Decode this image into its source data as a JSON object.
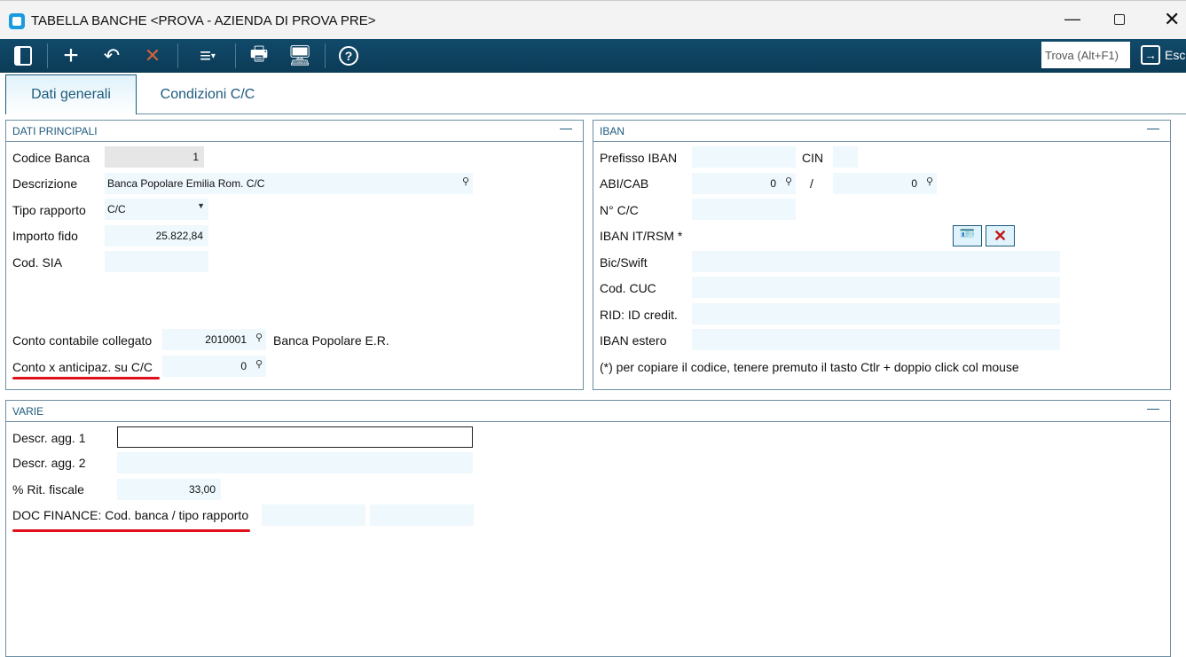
{
  "window": {
    "title": "TABELLA BANCHE <PROVA - AZIENDA DI PROVA PRE>"
  },
  "toolbar": {
    "search_placeholder": "Trova (Alt+F1)",
    "exit_label": "Esci"
  },
  "tabs": [
    {
      "label": "Dati generali",
      "active": true
    },
    {
      "label": "Condizioni C/C",
      "active": false
    }
  ],
  "dati_principali": {
    "title": "DATI PRINCIPALI",
    "codice_banca_label": "Codice Banca",
    "codice_banca": "1",
    "descrizione_label": "Descrizione",
    "descrizione": "Banca Popolare Emilia Rom. C/C",
    "tipo_rapporto_label": "Tipo rapporto",
    "tipo_rapporto": "C/C",
    "importo_fido_label": "Importo fido",
    "importo_fido": "25.822,84",
    "cod_sia_label": "Cod. SIA",
    "cod_sia": "",
    "conto_collegato_label": "Conto contabile collegato",
    "conto_collegato": "2010001",
    "conto_collegato_desc": "Banca Popolare E.R.",
    "conto_anticipaz_label": "Conto x anticipaz. su C/C",
    "conto_anticipaz": "0"
  },
  "iban": {
    "title": "IBAN",
    "prefisso_label": "Prefisso IBAN",
    "cin_label": "CIN",
    "abicab_label": "ABI/CAB",
    "abi": "0",
    "slash": "/",
    "cab": "0",
    "nconto_label": "N° C/C",
    "iban_it_label": "IBAN IT/RSM *",
    "bic_label": "Bic/Swift",
    "cuc_label": "Cod. CUC",
    "rid_label": "RID: ID credit.",
    "iban_estero_label": "IBAN estero",
    "note": "(*) per copiare il codice, tenere premuto il tasto Ctlr + doppio click col mouse"
  },
  "varie": {
    "title": "VARIE",
    "descr1_label": "Descr. agg. 1",
    "descr1": "",
    "descr2_label": "Descr. agg. 2",
    "descr2": "",
    "rit_label": "% Rit. fiscale",
    "rit": "33,00",
    "doc_label": "DOC FINANCE: Cod. banca / tipo rapporto"
  },
  "colors": {
    "toolbar": "#0f4462",
    "accent": "#1d5a7c",
    "field_bg": "#eef8fd",
    "highlight": "#e0101a"
  }
}
